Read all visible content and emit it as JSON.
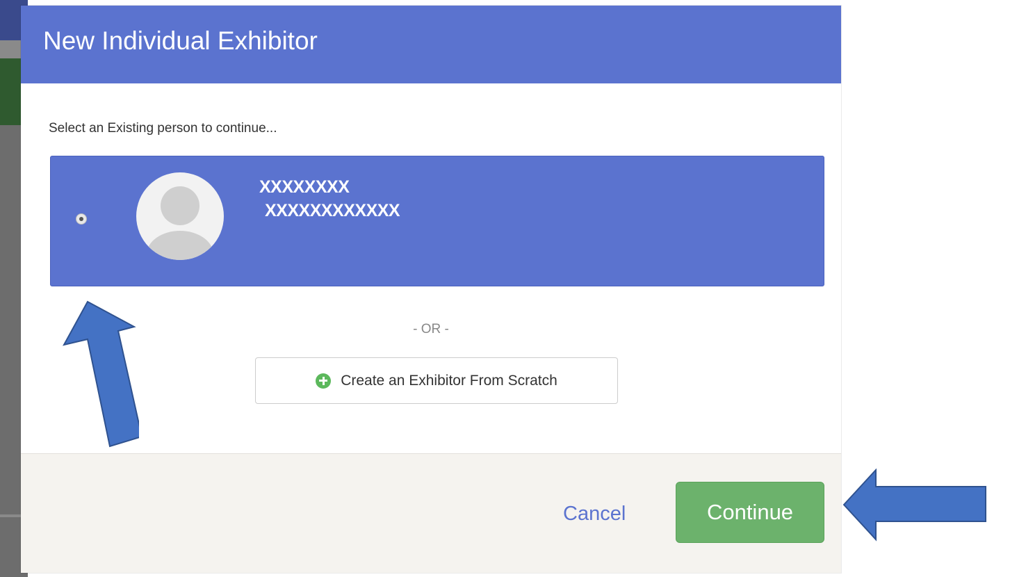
{
  "modal": {
    "title": "New Individual Exhibitor",
    "instruction": "Select an Existing person to continue...",
    "person": {
      "name": "XXXXXXXX",
      "detail": "XXXXXXXXXXXX",
      "selected": true
    },
    "or_text": "- OR -",
    "create_button_label": "Create an Exhibitor From Scratch",
    "footer": {
      "cancel_label": "Cancel",
      "continue_label": "Continue"
    }
  },
  "colors": {
    "header": "#5b73cf",
    "selected_card": "#5b73cf",
    "continue": "#6cb26c",
    "plus_icon": "#5cb85c",
    "annotation_arrow": "#4472c4"
  },
  "icons": {
    "create": "plus-circle-icon",
    "avatar": "default-avatar-icon",
    "annotations": [
      "arrow-up-icon",
      "arrow-left-icon"
    ]
  }
}
